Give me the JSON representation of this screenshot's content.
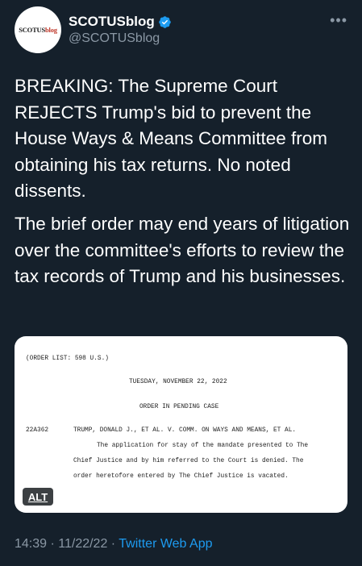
{
  "account": {
    "display_name": "SCOTUSblog",
    "handle": "@SCOTUSblog",
    "avatar_text_a": "SCOTUS",
    "avatar_text_b": "blog",
    "verified_icon": "verified-badge-icon",
    "more_icon": "more-horizontal-icon",
    "more_glyph": "•••"
  },
  "tweet": {
    "paragraph_1": "BREAKING: The Supreme Court REJECTS Trump's bid to prevent the House Ways & Means Committee from obtaining his tax returns. No noted dissents.",
    "paragraph_2": "The brief order may end years of litigation over the committee's efforts to review the tax records of Trump and his businesses."
  },
  "media": {
    "alt_label": "ALT",
    "document": {
      "order_list": "(ORDER LIST:  598 U.S.)",
      "date": "TUESDAY, NOVEMBER 22, 2022",
      "heading": "ORDER IN PENDING CASE",
      "docket": "22A362",
      "case_title": "TRUMP, DONALD J., ET AL. V. COMM. ON WAYS AND MEANS, ET AL.",
      "line_1": "The application for stay of the mandate presented to The",
      "line_2": "Chief Justice and by him referred to the Court is denied.  The",
      "line_3": "order heretofore entered by The Chief Justice is vacated."
    }
  },
  "meta": {
    "time_date": "14:39 · 11/22/22 · ",
    "source": "Twitter Web App"
  },
  "colors": {
    "background": "#15202b",
    "text": "#ffffff",
    "secondary": "#8b98a5",
    "accent": "#1d9bf0"
  }
}
